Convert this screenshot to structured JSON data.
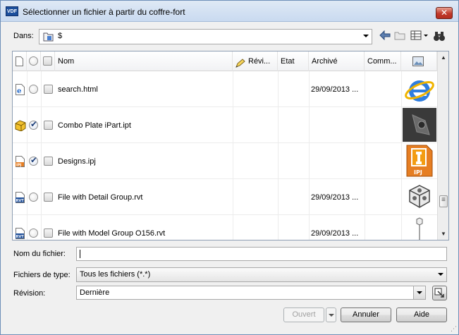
{
  "window": {
    "title": "Sélectionner un fichier à partir du coffre-fort",
    "app_icon_text": "VDF",
    "close": "✕"
  },
  "location": {
    "label": "Dans:",
    "value": "$"
  },
  "toolbar": {
    "icons": [
      "back-arrow-icon",
      "up-folder-icon",
      "view-menu-icon",
      "find-binoculars-icon"
    ]
  },
  "columns": {
    "name": "Nom",
    "revision": "Révi...",
    "state": "Etat",
    "archived": "Archivé",
    "comment": "Comm..."
  },
  "files": [
    {
      "name": "search.html",
      "archived": "29/09/2013 ...",
      "checked": false,
      "icon": "html-file-icon",
      "thumb": "ie-logo-icon"
    },
    {
      "name": "Combo Plate iPart.ipt",
      "archived": "",
      "checked": true,
      "icon": "part-file-icon",
      "thumb": "metal-part-thumbnail"
    },
    {
      "name": "Designs.ipj",
      "archived": "",
      "checked": true,
      "icon": "project-file-icon",
      "thumb": "ipj-thumbnail"
    },
    {
      "name": "File with Detail Group.rvt",
      "archived": "29/09/2013 ...",
      "checked": false,
      "icon": "rvt-file-icon",
      "thumb": "cube-thumbnail"
    },
    {
      "name": "File with Model Group O156.rvt",
      "archived": "29/09/2013 ...",
      "checked": false,
      "icon": "rvt-file-icon",
      "thumb": "pin-thumbnail"
    }
  ],
  "thumb_labels": {
    "ipj": "IPJ",
    "rvt": "RVT"
  },
  "filename": {
    "label": "Nom du fichier:",
    "value": ""
  },
  "filetype": {
    "label": "Fichiers de type:",
    "value": "Tous les fichiers (*.*)"
  },
  "revision": {
    "label": "Révision:",
    "value": "Dernière"
  },
  "buttons": {
    "open": "Ouvert",
    "cancel": "Annuler",
    "help": "Aide"
  },
  "colors": {
    "accent": "#1c4f9c",
    "title_bar": "#c9daf0",
    "close": "#c0392b"
  }
}
